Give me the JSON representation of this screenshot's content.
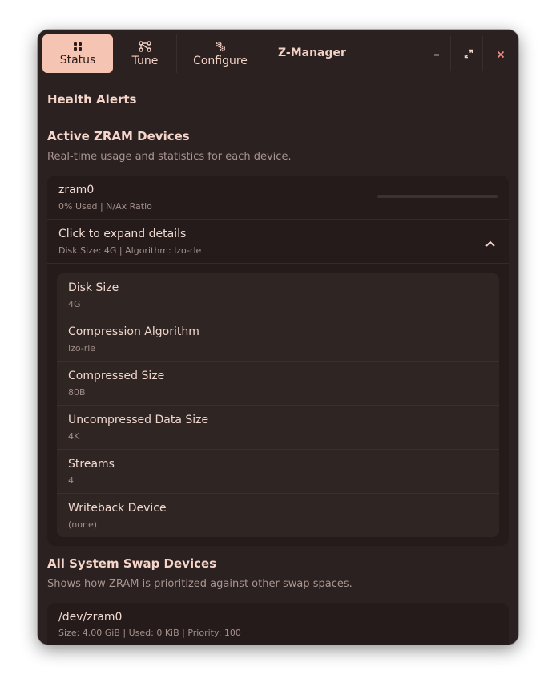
{
  "header": {
    "tabs": [
      {
        "label": "Status",
        "icon": "grid-icon",
        "active": true
      },
      {
        "label": "Tune",
        "icon": "nodes-icon",
        "active": false
      },
      {
        "label": "Configure",
        "icon": "gears-icon",
        "active": false
      }
    ],
    "title": "Z-Manager"
  },
  "health": {
    "title": "Health Alerts"
  },
  "zram": {
    "title": "Active ZRAM Devices",
    "subtitle": "Real-time usage and statistics for each device.",
    "device": {
      "name": "zram0",
      "summary": "0% Used | N/Ax Ratio",
      "usage_fraction": 0
    },
    "expander": {
      "title": "Click to expand details",
      "summary": "Disk Size: 4G | Algorithm: lzo-rle"
    },
    "details": [
      {
        "label": "Disk Size",
        "value": "4G"
      },
      {
        "label": "Compression Algorithm",
        "value": "lzo-rle"
      },
      {
        "label": "Compressed Size",
        "value": "80B"
      },
      {
        "label": "Uncompressed Data Size",
        "value": "4K"
      },
      {
        "label": "Streams",
        "value": "4"
      },
      {
        "label": "Writeback Device",
        "value": "(none)"
      }
    ]
  },
  "swap": {
    "title": "All System Swap Devices",
    "subtitle": "Shows how ZRAM is prioritized against other swap spaces.",
    "devices": [
      {
        "name": "/dev/zram0",
        "summary": "Size: 4.00 GiB | Used: 0 KiB | Priority: 100"
      }
    ]
  },
  "colors": {
    "accent": "#f6c4b2",
    "window_bg": "#2b2120",
    "close": "#f08a7a"
  }
}
